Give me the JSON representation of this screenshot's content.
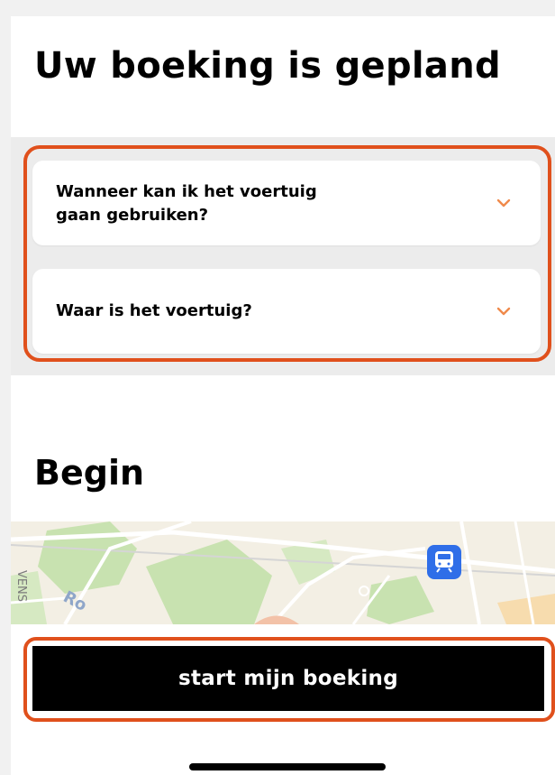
{
  "header": {
    "title": "Uw boeking is gepland"
  },
  "faq": {
    "items": [
      {
        "question": "Wanneer kan ik het voertuig gaan gebruiken?",
        "icon": "chevron-down-icon"
      },
      {
        "question": "Waar is het voertuig?",
        "icon": "chevron-down-icon"
      }
    ]
  },
  "begin": {
    "heading": "Begin"
  },
  "map": {
    "labels": [
      "Ro",
      "VENS"
    ],
    "marker_icon": "train-station-icon"
  },
  "action": {
    "start_label": "start mijn boeking"
  },
  "colors": {
    "accent": "#f08a4b",
    "highlight": "#e0501c",
    "button_bg": "#000000",
    "button_text": "#ffffff"
  }
}
